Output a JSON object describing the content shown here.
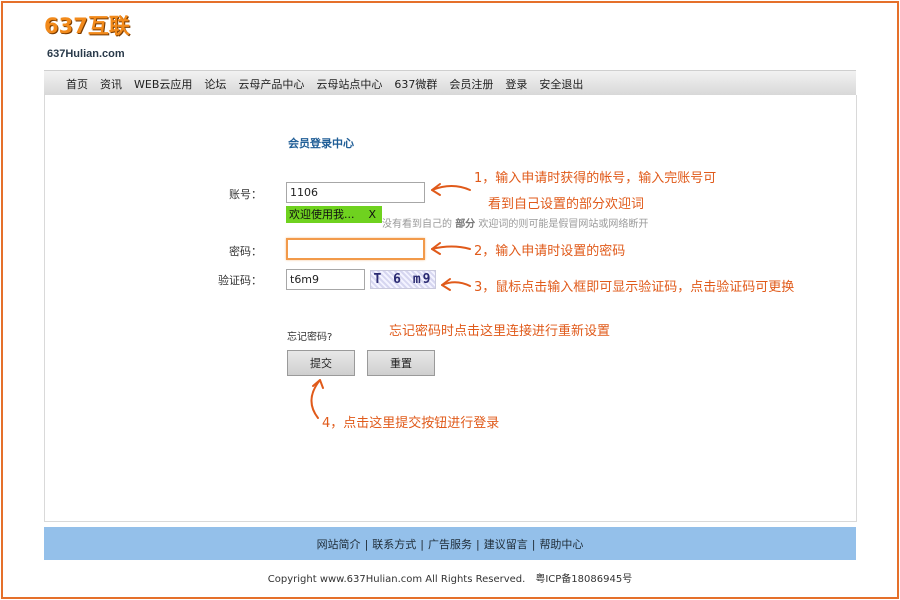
{
  "logo": {
    "title": "637互联",
    "subtitle": "637Hulian.com"
  },
  "nav": {
    "items": [
      "首页",
      "资讯",
      "WEB云应用",
      "论坛",
      "云母产品中心",
      "云母站点中心",
      "637微群",
      "会员注册",
      "登录",
      "安全退出"
    ]
  },
  "login": {
    "title": "会员登录中心",
    "account_label": "账号：",
    "account_value": "1106",
    "welcome_tip": "欢迎使用我...",
    "welcome_close": "X",
    "hint_prefix": "没有看到自己的",
    "hint_bold": "部分",
    "hint_suffix": "欢迎词的则可能是假冒网站或网络断开",
    "password_label": "密码：",
    "password_value": "",
    "captcha_label": "验证码：",
    "captcha_value": "t6m9",
    "captcha_image_text": "T 6 m9",
    "forgot": "忘记密码?",
    "submit": "提交",
    "reset": "重置"
  },
  "annotations": {
    "a1_line1": "1，输入申请时获得的帐号，输入完账号可",
    "a1_line2": "看到自己设置的部分欢迎词",
    "a2": "2，输入申请时设置的密码",
    "a3": "3，鼠标点击输入框即可显示验证码，点击验证码可更换",
    "a_forgot": "忘记密码时点击这里连接进行重新设置",
    "a4": "4，点击这里提交按钮进行登录"
  },
  "footer": {
    "links": [
      "网站简介",
      "联系方式",
      "广告服务",
      "建议留言",
      "帮助中心"
    ],
    "separator": "|",
    "copyright": "Copyright www.637Hulian.com All Rights Reserved.",
    "icp": "粤ICP备18086945号"
  },
  "colors": {
    "accent_orange": "#e05a1a",
    "frame": "#e5702a",
    "footer_bg": "#94c0ea",
    "welcome_bg": "#6fd21f",
    "title_blue": "#1f5d96"
  }
}
